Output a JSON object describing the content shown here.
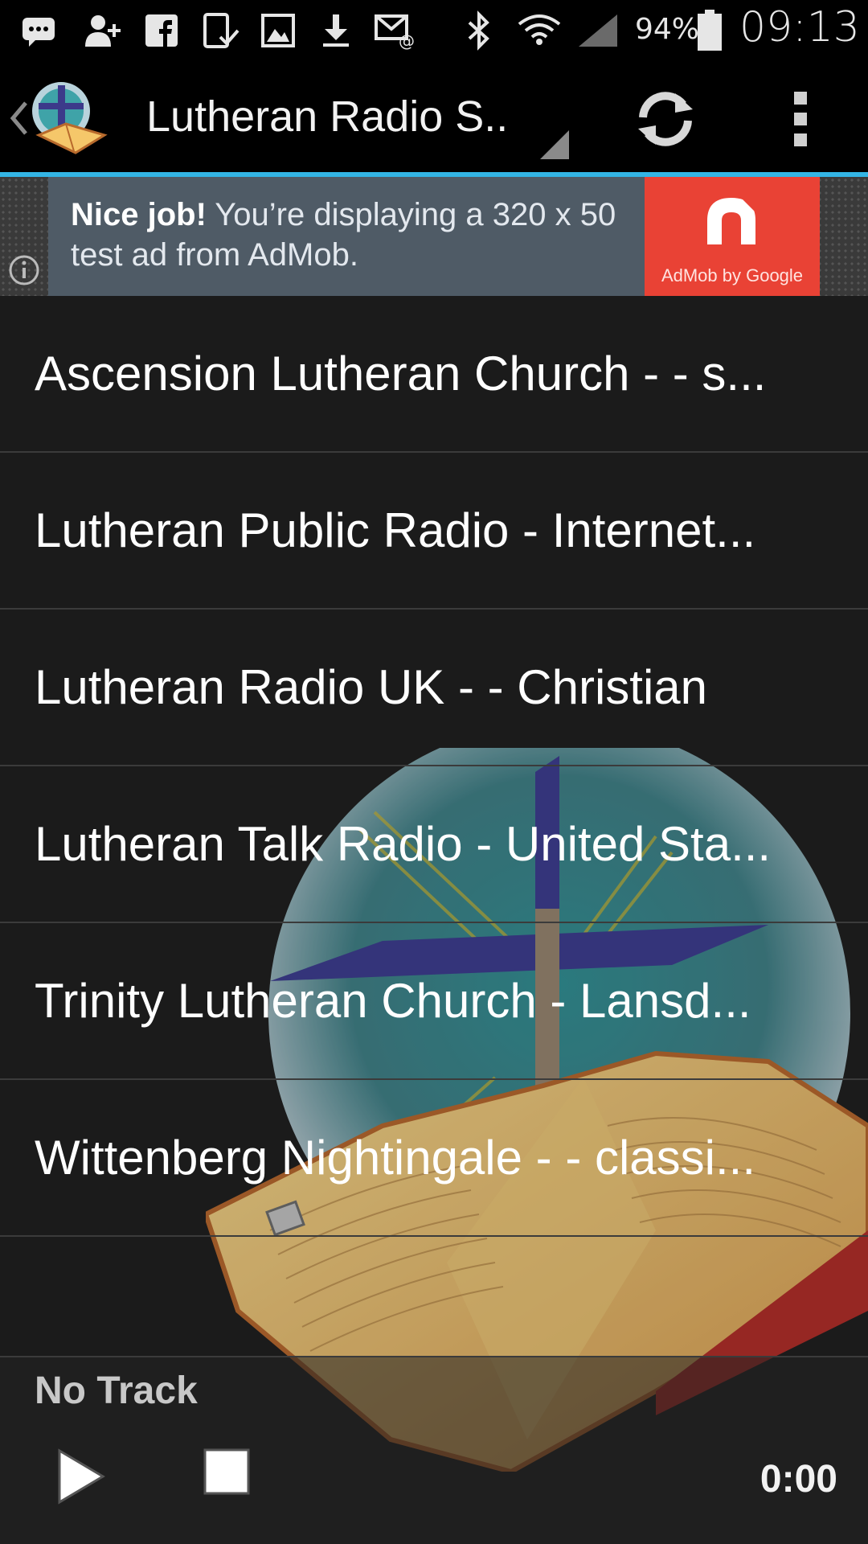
{
  "status_bar": {
    "battery_percent": "94%",
    "time": "09:13",
    "icons": [
      "messaging-icon",
      "add-contact-icon",
      "facebook-icon",
      "tablet-check-icon",
      "image-icon",
      "download-icon",
      "email-sync-icon",
      "bluetooth-icon",
      "wifi-icon",
      "cell-signal-icon",
      "battery-icon"
    ]
  },
  "action_bar": {
    "title": "Lutheran Radio S..",
    "accent_color": "#33b5e5"
  },
  "ad": {
    "bold_text": "Nice job!",
    "body_text": " You’re displaying a 320 x 50 test ad from AdMob.",
    "logo_text": "AdMob by Google",
    "logo_color": "#e94235"
  },
  "stations": [
    {
      "label": "Ascension Lutheran Church - - s..."
    },
    {
      "label": "Lutheran Public Radio - Internet..."
    },
    {
      "label": "Lutheran Radio UK - - Christian"
    },
    {
      "label": "Lutheran Talk Radio - United Sta..."
    },
    {
      "label": "Trinity Lutheran Church - Lansd..."
    },
    {
      "label": "Wittenberg Nightingale - - classi..."
    }
  ],
  "player": {
    "track": "No Track",
    "elapsed": "0:00"
  }
}
